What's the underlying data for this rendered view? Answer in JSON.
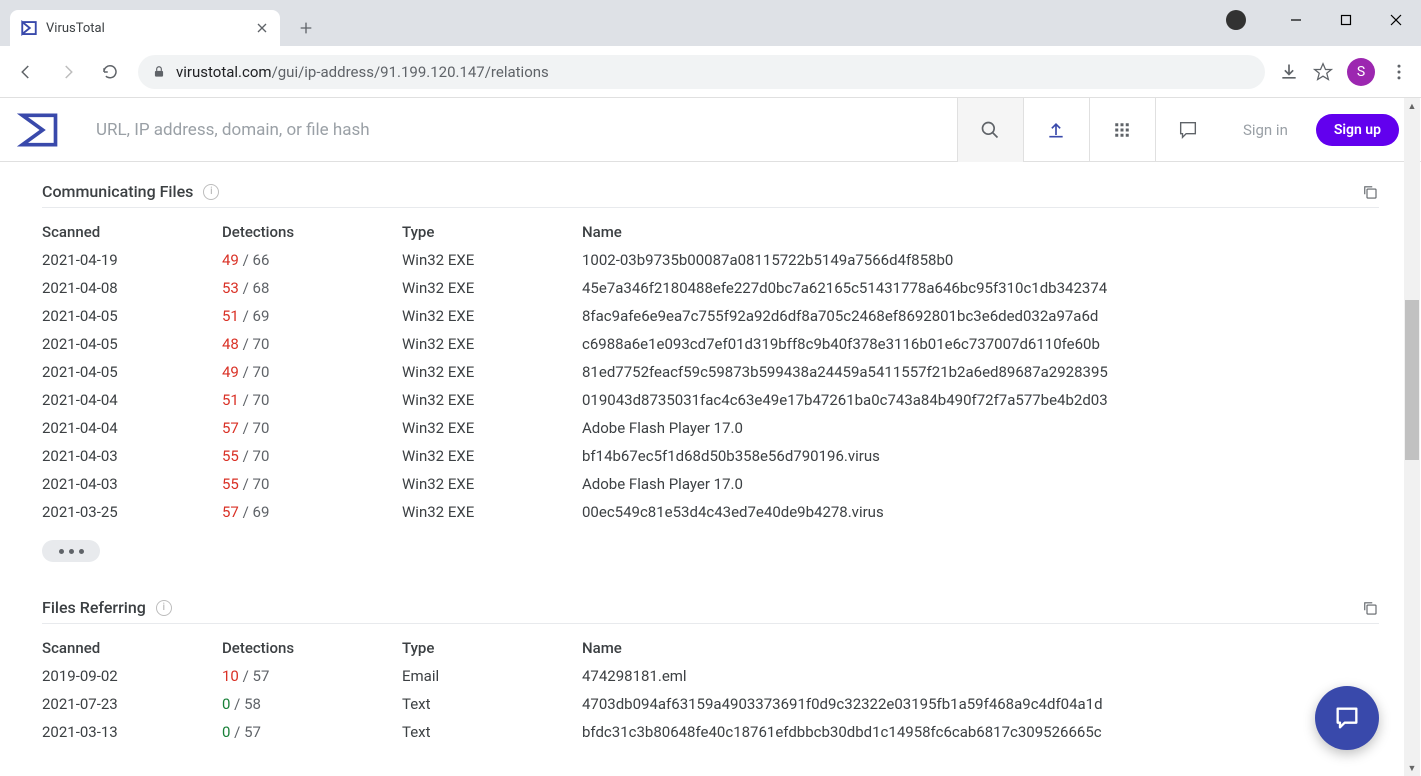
{
  "browser": {
    "tab_title": "VirusTotal",
    "url_host": "virustotal.com",
    "url_path": "/gui/ip-address/91.199.120.147/relations",
    "avatar_initial": "S"
  },
  "vt_header": {
    "search_placeholder": "URL, IP address, domain, or file hash",
    "signin": "Sign in",
    "signup": "Sign up"
  },
  "sections": {
    "communicating": {
      "title": "Communicating Files",
      "cols": {
        "scanned": "Scanned",
        "detections": "Detections",
        "type": "Type",
        "name": "Name"
      },
      "rows": [
        {
          "scanned": "2021-04-19",
          "pos": "49",
          "total": "66",
          "type": "Win32 EXE",
          "name": "1002-03b9735b00087a08115722b5149a7566d4f858b0"
        },
        {
          "scanned": "2021-04-08",
          "pos": "53",
          "total": "68",
          "type": "Win32 EXE",
          "name": "45e7a346f2180488efe227d0bc7a62165c51431778a646bc95f310c1db342374"
        },
        {
          "scanned": "2021-04-05",
          "pos": "51",
          "total": "69",
          "type": "Win32 EXE",
          "name": "8fac9afe6e9ea7c755f92a92d6df8a705c2468ef8692801bc3e6ded032a97a6d"
        },
        {
          "scanned": "2021-04-05",
          "pos": "48",
          "total": "70",
          "type": "Win32 EXE",
          "name": "c6988a6e1e093cd7ef01d319bff8c9b40f378e3116b01e6c737007d6110fe60b"
        },
        {
          "scanned": "2021-04-05",
          "pos": "49",
          "total": "70",
          "type": "Win32 EXE",
          "name": "81ed7752feacf59c59873b599438a24459a5411557f21b2a6ed89687a2928395"
        },
        {
          "scanned": "2021-04-04",
          "pos": "51",
          "total": "70",
          "type": "Win32 EXE",
          "name": "019043d8735031fac4c63e49e17b47261ba0c743a84b490f72f7a577be4b2d03"
        },
        {
          "scanned": "2021-04-04",
          "pos": "57",
          "total": "70",
          "type": "Win32 EXE",
          "name": "Adobe Flash Player 17.0"
        },
        {
          "scanned": "2021-04-03",
          "pos": "55",
          "total": "70",
          "type": "Win32 EXE",
          "name": "bf14b67ec5f1d68d50b358e56d790196.virus"
        },
        {
          "scanned": "2021-04-03",
          "pos": "55",
          "total": "70",
          "type": "Win32 EXE",
          "name": "Adobe Flash Player 17.0"
        },
        {
          "scanned": "2021-03-25",
          "pos": "57",
          "total": "69",
          "type": "Win32 EXE",
          "name": "00ec549c81e53d4c43ed7e40de9b4278.virus"
        }
      ]
    },
    "referring": {
      "title": "Files Referring",
      "cols": {
        "scanned": "Scanned",
        "detections": "Detections",
        "type": "Type",
        "name": "Name"
      },
      "rows": [
        {
          "scanned": "2019-09-02",
          "pos": "10",
          "total": "57",
          "type": "Email",
          "name": "474298181.eml"
        },
        {
          "scanned": "2021-07-23",
          "pos": "0",
          "total": "58",
          "type": "Text",
          "name": "4703db094af63159a4903373691f0d9c32322e03195fb1a59f468a9c4df04a1d"
        },
        {
          "scanned": "2021-03-13",
          "pos": "0",
          "total": "57",
          "type": "Text",
          "name": "bfdc31c3b80648fe40c18761efdbbcb30dbd1c14958fc6cab6817c309526665c"
        }
      ]
    }
  }
}
